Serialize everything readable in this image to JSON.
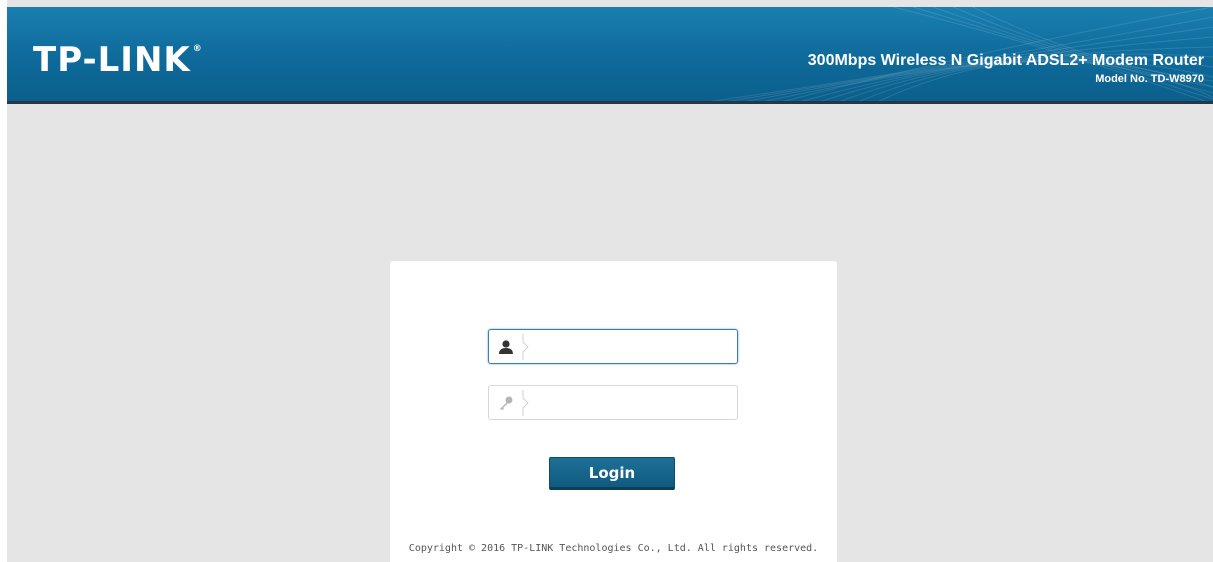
{
  "header": {
    "logo_text": "TP-LINK",
    "logo_mark": "®",
    "product_name": "300Mbps Wireless N Gigabit ADSL2+ Modem Router",
    "model_no": "Model No. TD-W8970"
  },
  "login": {
    "username_icon": "user-icon",
    "username_value": "",
    "password_icon": "key-icon",
    "password_value": "",
    "button_label": "Login"
  },
  "footer": {
    "copyright": "Copyright © 2016 TP-LINK Technologies Co., Ltd. All rights reserved."
  },
  "colors": {
    "header_blue": "#0e6a9a",
    "button_blue": "#105b80",
    "page_bg": "#e5e5e5",
    "focus_border": "#3a7fb0"
  }
}
